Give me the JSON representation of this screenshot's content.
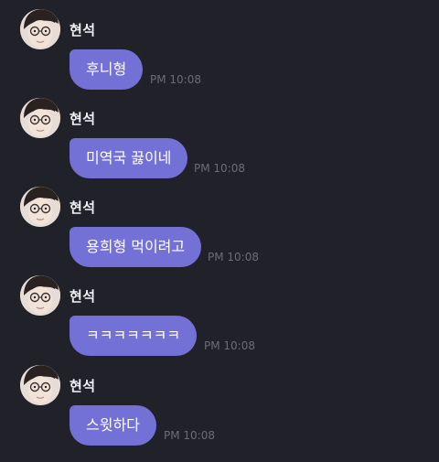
{
  "conversation": {
    "messages": [
      {
        "sender": "현석",
        "avatar": "user-avatar-photo",
        "text": "후니형",
        "time": "PM 10:08"
      },
      {
        "sender": "현석",
        "avatar": "user-avatar-photo",
        "text": "미역국 끓이네",
        "time": "PM 10:08"
      },
      {
        "sender": "현석",
        "avatar": "user-avatar-photo",
        "text": "용희형 먹이려고",
        "time": "PM 10:08"
      },
      {
        "sender": "현석",
        "avatar": "user-avatar-photo",
        "text": "ㅋㅋㅋㅋㅋㅋㅋ",
        "time": "PM 10:08"
      },
      {
        "sender": "현석",
        "avatar": "user-avatar-photo",
        "text": "스윗하다",
        "time": "PM 10:08"
      }
    ]
  },
  "colors": {
    "background": "#212129",
    "bubble": "#7471d6",
    "timestamp": "#6c6c78",
    "sender": "#f1f1f4"
  }
}
